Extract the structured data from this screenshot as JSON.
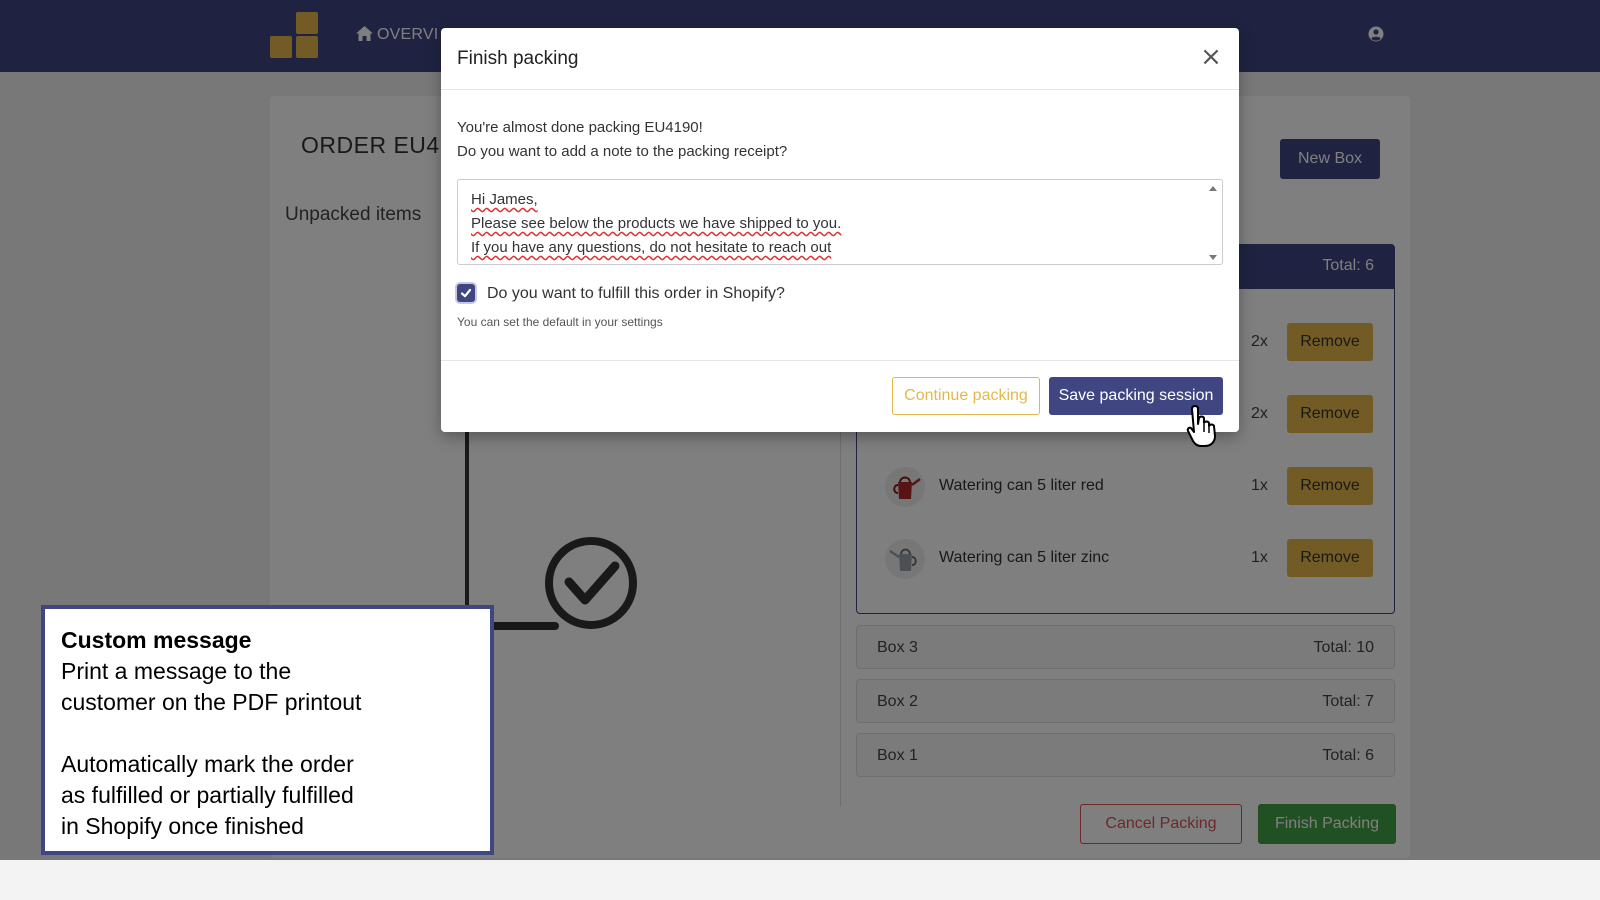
{
  "nav": {
    "overview_label": "OVERVI",
    "colors": {
      "bar": "#3f4682",
      "logo": "#e4b74a"
    }
  },
  "order": {
    "title": "ORDER EU4",
    "unpacked_title": "Unpacked items",
    "new_box_label": "New Box"
  },
  "active_box": {
    "total_label": "Total: 6",
    "items": [
      {
        "name": "",
        "qty": "2x",
        "remove_label": "Remove"
      },
      {
        "name": "",
        "qty": "2x",
        "remove_label": "Remove"
      },
      {
        "name": "Watering can 5 liter red",
        "qty": "1x",
        "remove_label": "Remove",
        "icon": "red-watering-can-icon"
      },
      {
        "name": "Watering can 5 liter zinc",
        "qty": "1x",
        "remove_label": "Remove",
        "icon": "zinc-watering-can-icon"
      }
    ]
  },
  "boxes": [
    {
      "name": "Box 3",
      "total": "Total: 10"
    },
    {
      "name": "Box 2",
      "total": "Total: 7"
    },
    {
      "name": "Box 1",
      "total": "Total: 6"
    }
  ],
  "actions": {
    "cancel_label": "Cancel Packing",
    "finish_label": "Finish Packing"
  },
  "modal": {
    "title": "Finish packing",
    "close": "×",
    "line1": "You're almost done packing EU4190!",
    "line2": "Do you want to add a note to the packing receipt?",
    "note_lines": [
      "Hi James,",
      "Please see below the products we have shipped to you.",
      "If you have any questions, do not hesitate to reach out"
    ],
    "fulfill_checked": true,
    "fulfill_label": "Do you want to fulfill this order in Shopify?",
    "hint": "You can set the default in your settings",
    "continue_label": "Continue packing",
    "save_label": "Save packing session"
  },
  "callout": {
    "title": "Custom message",
    "line1": "Print a message to the",
    "line2": "customer on the PDF printout",
    "line3": "Automatically mark the order",
    "line4": "as fulfilled or partially fulfilled",
    "line5": "in Shopify once finished"
  }
}
